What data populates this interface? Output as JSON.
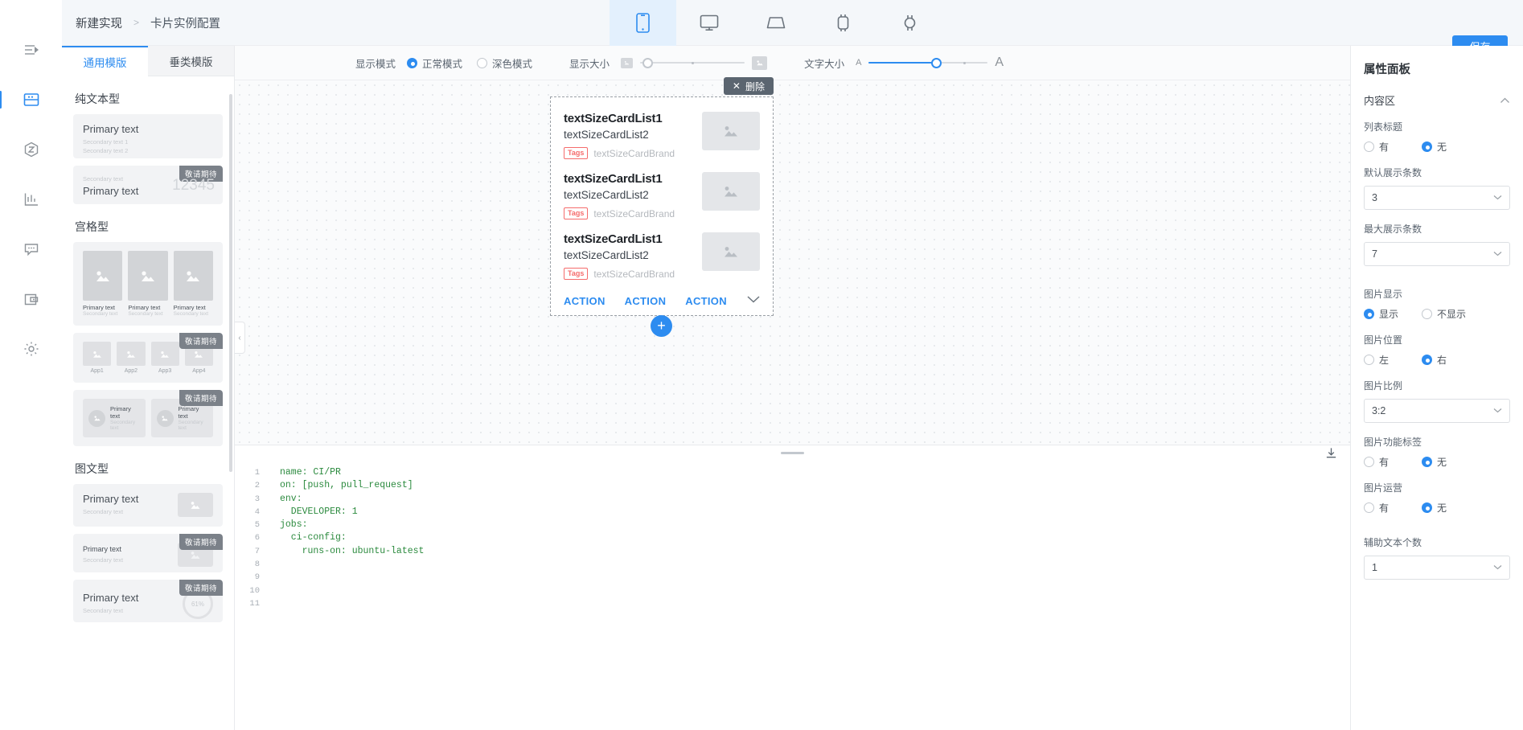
{
  "rail": {
    "items": [
      {
        "name": "menu-collapse-icon",
        "active": false
      },
      {
        "name": "card-layout-icon",
        "active": true
      },
      {
        "name": "component-icon",
        "active": false
      },
      {
        "name": "chart-icon",
        "active": false
      },
      {
        "name": "message-icon",
        "active": false
      },
      {
        "name": "wallet-icon",
        "active": false
      },
      {
        "name": "settings-icon",
        "active": false
      }
    ]
  },
  "topbar": {
    "breadcrumb": [
      "新建实现",
      ">",
      "卡片实例配置"
    ],
    "save_label": "保存",
    "devices": [
      {
        "name": "phone-device",
        "active": true
      },
      {
        "name": "desktop-device",
        "active": false
      },
      {
        "name": "tablet-device",
        "active": false
      },
      {
        "name": "watch-square-device",
        "active": false
      },
      {
        "name": "watch-round-device",
        "active": false
      }
    ]
  },
  "template_pane": {
    "tabs": [
      {
        "label": "通用模版",
        "active": true
      },
      {
        "label": "垂类模版",
        "active": false
      }
    ],
    "groups": [
      {
        "title": "纯文本型",
        "cards": [
          {
            "type": "text-block",
            "primary": "Primary text",
            "secondary1": "Secondary text 1",
            "secondary2": "Secondary text 2"
          },
          {
            "type": "text-number",
            "secondary": "Secondary text",
            "primary": "Primary text",
            "number": "12345",
            "badge": "敬请期待"
          }
        ]
      },
      {
        "title": "宫格型",
        "cards": [
          {
            "type": "grid3",
            "cells": [
              {
                "primary": "Primary text",
                "secondary": "Secondary text"
              },
              {
                "primary": "Primary text",
                "secondary": "Secondary text"
              },
              {
                "primary": "Primary text",
                "secondary": "Secondary text"
              }
            ]
          },
          {
            "type": "grid4",
            "badge": "敬请期待",
            "cells": [
              {
                "caption": "App1"
              },
              {
                "caption": "App2"
              },
              {
                "caption": "App3"
              },
              {
                "caption": "App4"
              }
            ]
          },
          {
            "type": "row2",
            "badge": "敬请期待",
            "cells": [
              {
                "primary": "Primary text",
                "secondary": "Secondary text"
              },
              {
                "primary": "Primary text",
                "secondary": "Secondary text"
              }
            ]
          }
        ]
      },
      {
        "title": "图文型",
        "cards": [
          {
            "type": "img-right-lg",
            "primary": "Primary text",
            "secondary": "Secondary text"
          },
          {
            "type": "img-right-sm",
            "badge": "敬请期待",
            "primary": "Primary text",
            "secondary": "Secondary text"
          },
          {
            "type": "ring-right",
            "badge": "敬请期待",
            "primary": "Primary text",
            "secondary": "Secondary text",
            "ring_value": "61%"
          }
        ]
      }
    ]
  },
  "viewbar": {
    "display_mode_label": "显示模式",
    "modes": [
      {
        "label": "正常模式",
        "selected": true
      },
      {
        "label": "深色模式",
        "selected": false
      }
    ],
    "display_size_label": "显示大小",
    "display_size_percent": 8,
    "text_size_label": "文字大小",
    "text_size_percent": 57,
    "text_small_glyph": "A",
    "text_large_glyph": "A"
  },
  "canvas": {
    "delete_label": "删除",
    "delete_icon": "close-icon",
    "add_button_glyph": "+",
    "collapse_glyph": "‹",
    "card": {
      "rows": [
        {
          "line1": "textSizeCardList1",
          "line2": "textSizeCardList2",
          "tag": "Tags",
          "brand": "textSizeCardBrand"
        },
        {
          "line1": "textSizeCardList1",
          "line2": "textSizeCardList2",
          "tag": "Tags",
          "brand": "textSizeCardBrand"
        },
        {
          "line1": "textSizeCardList1",
          "line2": "textSizeCardList2",
          "tag": "Tags",
          "brand": "textSizeCardBrand"
        }
      ],
      "actions": [
        "ACTION",
        "ACTION",
        "ACTION"
      ],
      "expand_icon": "chevron-down-icon"
    }
  },
  "code": {
    "download_icon": "download-icon",
    "lines": [
      {
        "n": "1",
        "text": ""
      },
      {
        "n": "2",
        "text": "name: CI/PR"
      },
      {
        "n": "3",
        "text": ""
      },
      {
        "n": "4",
        "text": "on: [push, pull_request]"
      },
      {
        "n": "5",
        "text": ""
      },
      {
        "n": "6",
        "text": "env:"
      },
      {
        "n": "7",
        "text": "  DEVELOPER: 1"
      },
      {
        "n": "8",
        "text": ""
      },
      {
        "n": "9",
        "text": "jobs:"
      },
      {
        "n": "10",
        "text": "  ci-config:"
      },
      {
        "n": "11",
        "text": "    runs-on: ubuntu-latest"
      }
    ]
  },
  "props": {
    "title": "属性面板",
    "section": {
      "label": "内容区",
      "collapse_icon": "chevron-up-icon"
    },
    "fields": [
      {
        "kind": "radio",
        "label": "列表标题",
        "options": [
          {
            "label": "有",
            "selected": false
          },
          {
            "label": "无",
            "selected": true
          }
        ]
      },
      {
        "kind": "select",
        "label": "默认展示条数",
        "value": "3"
      },
      {
        "kind": "select",
        "label": "最大展示条数",
        "value": "7"
      },
      {
        "kind": "radio",
        "label": "图片显示",
        "options": [
          {
            "label": "显示",
            "selected": true
          },
          {
            "label": "不显示",
            "selected": false
          }
        ]
      },
      {
        "kind": "radio",
        "label": "图片位置",
        "options": [
          {
            "label": "左",
            "selected": false
          },
          {
            "label": "右",
            "selected": true
          }
        ]
      },
      {
        "kind": "select",
        "label": "图片比例",
        "value": "3:2"
      },
      {
        "kind": "radio",
        "label": "图片功能标签",
        "options": [
          {
            "label": "有",
            "selected": false
          },
          {
            "label": "无",
            "selected": true
          }
        ]
      },
      {
        "kind": "radio",
        "label": "图片运营",
        "options": [
          {
            "label": "有",
            "selected": false
          },
          {
            "label": "无",
            "selected": true
          }
        ]
      },
      {
        "kind": "select",
        "label": "辅助文本个数",
        "value": "1"
      }
    ]
  },
  "colors": {
    "accent": "#2d8cf0",
    "tag_red": "#f56c6c",
    "badge_gray": "#7b8189"
  }
}
